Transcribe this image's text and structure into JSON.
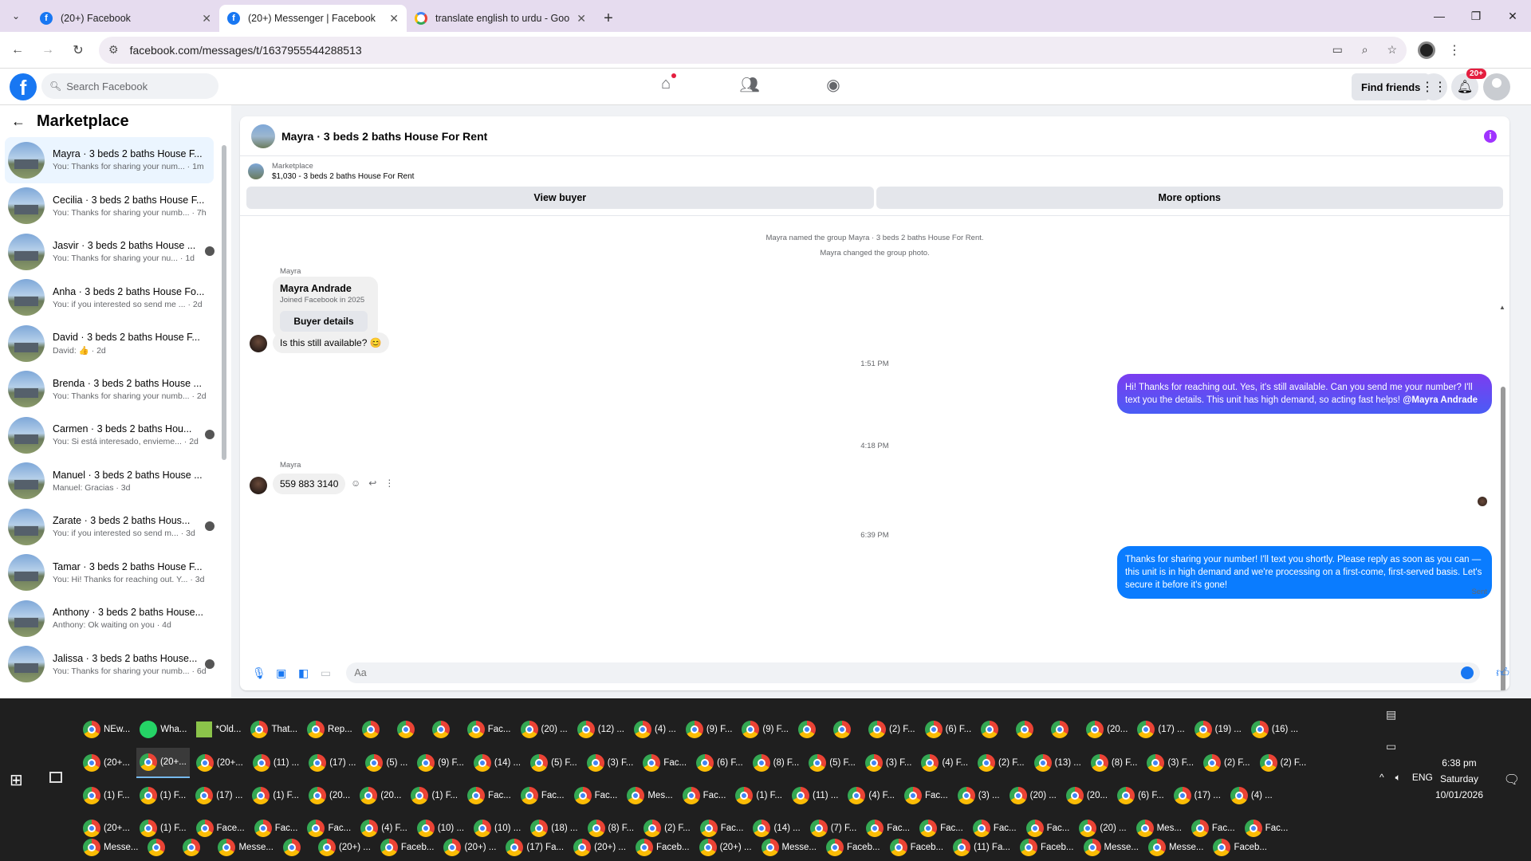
{
  "browser": {
    "tabs": [
      {
        "title": "(20+) Facebook",
        "icon": "facebook-icon",
        "active": false
      },
      {
        "title": "(20+) Messenger | Facebook",
        "icon": "facebook-icon",
        "active": true
      },
      {
        "title": "translate english to urdu - Goo",
        "icon": "google-icon",
        "active": false
      }
    ],
    "url": "facebook.com/messages/t/1637955544288513"
  },
  "fb": {
    "search_placeholder": "Search Facebook",
    "find_friends": "Find friends",
    "notif_count": "20+"
  },
  "sidebar": {
    "title": "Marketplace",
    "conversations": [
      {
        "name": "Mayra · 3 beds 2 baths House F...",
        "preview": "You: Thanks for sharing your num... · 1m"
      },
      {
        "name": "Cecilia · 3 beds 2 baths House F...",
        "preview": "You: Thanks for sharing your numb... · 7h"
      },
      {
        "name": "Jasvir · 3 beds 2 baths House ...",
        "preview": "You: Thanks for sharing your nu... · 1d"
      },
      {
        "name": "Anha · 3 beds 2 baths House Fo...",
        "preview": "You: if you interested so send me ... · 2d"
      },
      {
        "name": "David · 3 beds 2 baths House F...",
        "preview": "David: 👍 · 2d"
      },
      {
        "name": "Brenda · 3 beds 2 baths House ...",
        "preview": "You: Thanks for sharing your numb... · 2d"
      },
      {
        "name": "Carmen · 3 beds 2 baths Hou...",
        "preview": "You: Si está interesado, envieme... · 2d"
      },
      {
        "name": "Manuel · 3 beds 2 baths House ...",
        "preview": "Manuel: Gracias · 3d"
      },
      {
        "name": "Zarate · 3 beds 2 baths Hous...",
        "preview": "You: if you interested so send m... · 3d"
      },
      {
        "name": "Tamar · 3 beds 2 baths House F...",
        "preview": "You: Hi! Thanks for reaching out. Y... · 3d"
      },
      {
        "name": "Anthony · 3 beds 2 baths House...",
        "preview": "Anthony: Ok waiting on you · 4d"
      },
      {
        "name": "Jalissa · 3 beds 2 baths House...",
        "preview": "You: Thanks for sharing your numb... · 6d"
      }
    ]
  },
  "chat": {
    "title": "Mayra · 3 beds 2 baths House For Rent",
    "marketplace_label": "Marketplace",
    "listing": "$1,030 - 3 beds 2 baths House For Rent",
    "view_buyer": "View buyer",
    "more_options": "More options",
    "sys1": "Mayra named the group Mayra · 3 beds 2 baths House For Rent.",
    "sys2": "Mayra changed the group photo.",
    "sender": "Mayra",
    "card_name": "Mayra Andrade",
    "card_joined": "Joined Facebook in 2025",
    "card_button": "Buyer details",
    "msg1": "Is this still available? 😊",
    "ts1": "1:51 PM",
    "out1_text": "Hi! Thanks for reaching out. Yes, it's still available. Can you send me your number? I'll text you the details. This unit has high demand, so acting fast helps! ",
    "out1_mention": "@Mayra Andrade",
    "ts2": "4:18 PM",
    "msg2": "559 883 3140",
    "ts3": "6:39 PM",
    "out2_text": "Thanks for sharing your number! I'll text you shortly. Please reply as soon as you can — this unit is in high demand and we're processing on a first-come, first-served basis. Let's secure it before it's gone!",
    "sent_label": "Sent",
    "composer_placeholder": "Aa"
  },
  "taskbar": {
    "row1": [
      "NEw...",
      "Wha...",
      "*Old...",
      "That...",
      "Rep...",
      "",
      "",
      "",
      "Fac...",
      "(20) ...",
      "(12) ...",
      "(4) ...",
      "(9) F...",
      "(9) F...",
      "",
      "",
      "(2) F...",
      "(6) F...",
      "",
      "",
      "",
      "(20...",
      "(17) ...",
      "(19) ...",
      "(16) ..."
    ],
    "row2": [
      "(20+...",
      "(20+...",
      "(20+...",
      "(11) ...",
      "(17) ...",
      "(5) ...",
      "(9) F...",
      "(14) ...",
      "(5) F...",
      "(3) F...",
      "Fac...",
      "(6) F...",
      "(8) F...",
      "(5) F...",
      "(3) F...",
      "(4) F...",
      "(2) F...",
      "(13) ...",
      "(8) F...",
      "(3) F...",
      "(2) F...",
      "(2) F..."
    ],
    "row3": [
      "(1) F...",
      "(1) F...",
      "(17) ...",
      "(1) F...",
      "(20...",
      "(20...",
      "(1) F...",
      "Fac...",
      "Fac...",
      "Fac...",
      "Mes...",
      "Fac...",
      "(1) F...",
      "(11) ...",
      "(4) F...",
      "Fac...",
      "(3) ...",
      "(20) ...",
      "(20...",
      "(6) F...",
      "(17) ...",
      "(4) ..."
    ],
    "row4": [
      "(20+...",
      "(1) F...",
      "Face...",
      "Fac...",
      "Fac...",
      "(4) F...",
      "(10) ...",
      "(10) ...",
      "(18) ...",
      "(8) F...",
      "(2) F...",
      "Fac...",
      "(14) ...",
      "(7) F...",
      "Fac...",
      "Fac...",
      "Fac...",
      "Fac...",
      "(20) ...",
      "Mes...",
      "Fac...",
      "Fac..."
    ],
    "row5": [
      "Messe...",
      "",
      "",
      "Messe...",
      "",
      "(20+) ...",
      "Faceb...",
      "(20+) ...",
      "(17) Fa...",
      "(20+) ...",
      "Faceb...",
      "(20+) ...",
      "Messe...",
      "Faceb...",
      "Faceb...",
      "(11) Fa...",
      "Faceb...",
      "Messe...",
      "Messe...",
      "Faceb..."
    ],
    "time": "6:38 pm",
    "day": "Saturday",
    "date": "10/01/2026",
    "lang": "ENG"
  }
}
